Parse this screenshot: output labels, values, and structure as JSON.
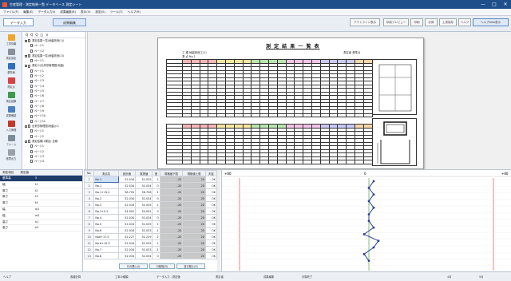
{
  "window": {
    "title": "生産管理 - 測定結果一覧 データベース 測定シート",
    "minimize": "—",
    "maximize": "□",
    "close": "✕"
  },
  "menu": [
    "ファイル(F)",
    "編集(E)",
    "データ入力(I)",
    "成果編集(R)",
    "表示(V)",
    "設定(S)",
    "ツール(T)",
    "ヘルプ(H)"
  ],
  "toolbar": {
    "tab_input": "データ入力",
    "tab_result": "成果編集",
    "btn_outline": "アウトライン表示",
    "btn_preview": "印刷プレビュー",
    "btn_print": "印刷",
    "btn_calc": "計算",
    "btn_save": "上書保存",
    "btn_help": "ヘルプ",
    "btn_web": "ヘルプWeb",
    "btn_web_active": "ヘルプWeb表示"
  },
  "sidebar": {
    "items": [
      {
        "label": "工事情報",
        "icon": "folder-icon"
      },
      {
        "label": "測定設定",
        "icon": "tool-icon"
      },
      {
        "label": "基準線",
        "icon": "flow-icon"
      },
      {
        "label": "測定点",
        "icon": "arrow-icon"
      },
      {
        "label": "測定結果",
        "icon": "chart-icon"
      },
      {
        "label": "成果確認",
        "icon": "document-icon"
      },
      {
        "label": "入力管理",
        "icon": "transfer-icon"
      },
      {
        "label": "フォーム",
        "icon": "form-icon"
      },
      {
        "label": "帳票出力",
        "icon": "tool2-icon"
      }
    ]
  },
  "tree": {
    "tools": [
      "Q",
      "Q",
      "Q",
      "◫",
      "✕"
    ],
    "nodes": [
      {
        "label": "測定結果一覧(地盤改良(1))",
        "level": 0,
        "type": "folder"
      },
      {
        "label": "ページ1",
        "level": 1,
        "type": "doc"
      },
      {
        "label": "ページ2",
        "level": 1,
        "type": "doc"
      },
      {
        "label": "測定結果一覧(地盤改良(2))",
        "level": 0,
        "type": "folder"
      },
      {
        "label": "ページ1",
        "level": 1,
        "type": "doc"
      },
      {
        "label": "測定(1)出来形管理図(地盤)",
        "level": 0,
        "type": "folder"
      },
      {
        "label": "ページ1",
        "level": 1,
        "type": "doc"
      },
      {
        "label": "ページ2",
        "level": 1,
        "type": "doc"
      },
      {
        "label": "ページ3",
        "level": 1,
        "type": "doc"
      },
      {
        "label": "ページ4",
        "level": 1,
        "type": "doc"
      },
      {
        "label": "ページ5",
        "level": 1,
        "type": "doc"
      },
      {
        "label": "ページ6",
        "level": 1,
        "type": "doc"
      },
      {
        "label": "ページ7",
        "level": 1,
        "type": "doc"
      },
      {
        "label": "ページ8",
        "level": 1,
        "type": "doc"
      },
      {
        "label": "ページ9",
        "level": 1,
        "type": "doc"
      },
      {
        "label": "ページ10",
        "level": 1,
        "type": "doc"
      },
      {
        "label": "ページ11",
        "level": 1,
        "type": "doc"
      },
      {
        "label": "出来形管理図(地盤)(2)",
        "level": 0,
        "type": "folder"
      },
      {
        "label": "ページ1",
        "level": 1,
        "type": "doc"
      },
      {
        "label": "ページ2",
        "level": 1,
        "type": "doc"
      },
      {
        "label": "測定結果(2層目) 全線",
        "level": 0,
        "type": "folder"
      },
      {
        "label": "ページ1",
        "level": 1,
        "type": "doc"
      },
      {
        "label": "ページ2",
        "level": 1,
        "type": "doc"
      },
      {
        "label": "ページ3",
        "level": 1,
        "type": "doc"
      },
      {
        "label": "ページ4",
        "level": 1,
        "type": "doc"
      }
    ]
  },
  "document": {
    "title": "測 定 結 果 一 覧 表",
    "meta_left": "工 種  地盤改良工(1)",
    "meta_left2": "測 点  No.1",
    "meta_right": "測定者  基準点",
    "header_colors": [
      "#f4b6b6",
      "#f9e79f",
      "#b7e4b0",
      "#f3c3e6",
      "#c9c9f5",
      "#f6d5a8"
    ]
  },
  "bottom_left": {
    "headers": [
      "測定項目",
      "測定値"
    ],
    "rows": [
      {
        "name": "基準高",
        "value": "5",
        "selected": true
      },
      {
        "name": "幅",
        "value": "t1",
        "selected": false
      },
      {
        "name": "厚さ",
        "value": "t2",
        "selected": false
      },
      {
        "name": "厚さ",
        "value": "t3",
        "selected": false
      },
      {
        "name": "厚さ",
        "value": "t4",
        "selected": false
      },
      {
        "name": "幅",
        "value": "w1",
        "selected": false
      },
      {
        "name": "幅",
        "value": "w2",
        "selected": false
      },
      {
        "name": "高さ",
        "value": "h1",
        "selected": false
      },
      {
        "name": "高さ",
        "value": "h2",
        "selected": false
      }
    ]
  },
  "data_table": {
    "headers": [
      "No.",
      "測点名",
      "設計値",
      "実測値",
      "差",
      "規格値下限",
      "規格値上限",
      "判定"
    ],
    "rows": [
      [
        "1",
        "No.1",
        "52.034",
        "52.035",
        "1",
        "-20",
        "20",
        "OK"
      ],
      [
        "2",
        "No.1",
        "52.034",
        "52.034",
        "0",
        "-20",
        "20",
        "OK"
      ],
      [
        "3",
        "No.1+15.1",
        "58.705",
        "58.706",
        "1",
        "-20",
        "20",
        "OK"
      ],
      [
        "4",
        "No.2",
        "52.034",
        "52.034",
        "0",
        "-20",
        "20",
        "OK"
      ],
      [
        "5",
        "No.3",
        "52.034",
        "52.035",
        "1",
        "-20",
        "20",
        "OK"
      ],
      [
        "6",
        "No.3+5.2",
        "54.002",
        "54.002",
        "0",
        "-20",
        "20",
        "OK"
      ],
      [
        "7",
        "No.4",
        "52.034",
        "52.034",
        "0",
        "-20",
        "20",
        "OK"
      ],
      [
        "8",
        "No.5",
        "52.034",
        "52.035",
        "1",
        "-20",
        "20",
        "OK"
      ],
      [
        "9",
        "No.6",
        "52.034",
        "52.033",
        "-1",
        "-20",
        "20",
        "OK"
      ],
      [
        "10",
        "No6+17.5",
        "52.227",
        "52.229",
        "2",
        "-20",
        "20",
        "OK"
      ],
      [
        "11",
        "No.6+15.3",
        "52.034",
        "52.035",
        "1",
        "-20",
        "20",
        "OK"
      ],
      [
        "12",
        "No.7",
        "52.034",
        "52.033",
        "-1",
        "-20",
        "20",
        "OK"
      ],
      [
        "13",
        "No.8",
        "52.034",
        "52.034",
        "0",
        "-20",
        "20",
        "OK"
      ]
    ],
    "btn_add": "行の挿入(I)",
    "btn_delete": "行削除(D)",
    "btn_sort": "並び替え(S)"
  },
  "chart": {
    "label_left": "+80",
    "label_mid": "0",
    "label_right": "+80",
    "line_color": "#2a3f9e",
    "limit_color_left": "#e06666",
    "limit_color_right": "#e06666",
    "center_color": "#6aa84f"
  },
  "status": {
    "items": [
      "ヘルプ",
      "各種計算",
      "工事の種類",
      "データ入力 - 測定値",
      "測定者",
      "成果編集",
      "計算終了",
      "4月",
      "5月"
    ]
  }
}
